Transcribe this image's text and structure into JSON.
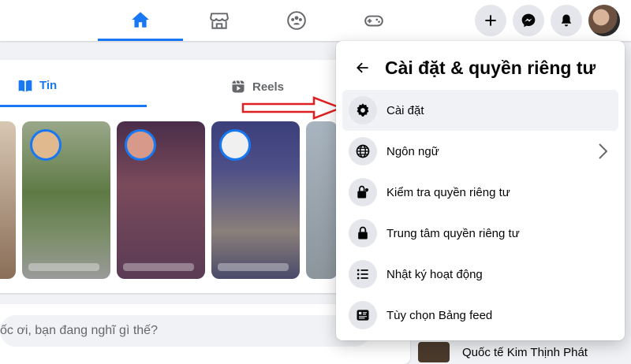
{
  "nav": {
    "tabs": [
      {
        "icon": "home-icon",
        "active": true
      },
      {
        "icon": "marketplace-icon",
        "active": false
      },
      {
        "icon": "groups-icon",
        "active": false
      },
      {
        "icon": "gaming-icon",
        "active": false
      }
    ],
    "actions": [
      "create-icon",
      "messenger-icon",
      "notifications-icon"
    ],
    "accent_color": "#1877f2"
  },
  "stories_tabs": {
    "stories_label": "Tin",
    "reels_label": "Reels"
  },
  "composer": {
    "placeholder": "ốc ơi, bạn đang nghĩ gì thế?"
  },
  "sidebar_contact": {
    "name": "Quốc tế Kim Thịnh Phát"
  },
  "menu": {
    "title": "Cài đặt & quyền riêng tư",
    "items": [
      {
        "label": "Cài đặt",
        "icon": "gear-icon"
      },
      {
        "label": "Ngôn ngữ",
        "icon": "globe-icon",
        "has_submenu": true
      },
      {
        "label": "Kiểm tra quyền riêng tư",
        "icon": "privacy-checkup-icon"
      },
      {
        "label": "Trung tâm quyền riêng tư",
        "icon": "lock-icon"
      },
      {
        "label": "Nhật ký hoạt động",
        "icon": "activity-log-icon"
      },
      {
        "label": "Tùy chọn Bảng feed",
        "icon": "feed-preferences-icon"
      }
    ]
  },
  "annotation": {
    "arrow_color": "#e02020"
  }
}
